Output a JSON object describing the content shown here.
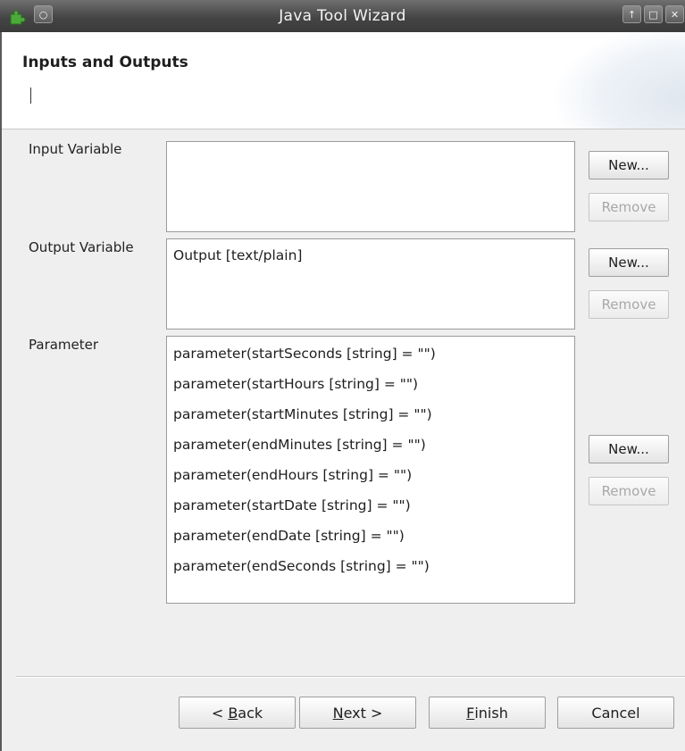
{
  "window": {
    "title": "Java Tool Wizard",
    "menu_icon": "circle-menu-icon",
    "app_icon": "puzzle-icon",
    "controls": [
      "up-icon",
      "maximize-icon",
      "close-icon"
    ]
  },
  "header": {
    "title": "Inputs and Outputs"
  },
  "input_section": {
    "label": "Input Variable",
    "items": [],
    "new_label": "New...",
    "remove_label": "Remove"
  },
  "output_section": {
    "label": "Output Variable",
    "items": [
      "Output [text/plain]"
    ],
    "new_label": "New...",
    "remove_label": "Remove"
  },
  "parameter_section": {
    "label": "Parameter",
    "items": [
      "parameter(startSeconds [string] = \"\")",
      "parameter(startHours [string] = \"\")",
      "parameter(startMinutes [string] = \"\")",
      "parameter(endMinutes [string] = \"\")",
      "parameter(endHours [string] = \"\")",
      "parameter(startDate [string] = \"\")",
      "parameter(endDate [string] = \"\")",
      "parameter(endSeconds [string] = \"\")"
    ],
    "new_label": "New...",
    "remove_label": "Remove"
  },
  "footer": {
    "back_prefix": "< ",
    "back_mnemonic": "B",
    "back_rest": "ack",
    "next_mnemonic": "N",
    "next_rest": "ext >",
    "finish_mnemonic": "F",
    "finish_rest": "inish",
    "cancel_label": "Cancel"
  },
  "colors": {
    "titlebar": "#454545",
    "background": "#efefef",
    "disabled_text": "#a8a8a8"
  }
}
